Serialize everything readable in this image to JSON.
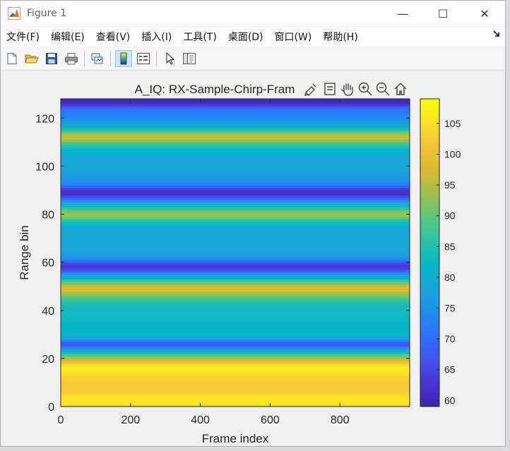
{
  "window": {
    "title": "Figure 1",
    "controls": {
      "minimize": "—",
      "maximize": "☐",
      "close": "✕"
    }
  },
  "menu": [
    "文件(F)",
    "编辑(E)",
    "查看(V)",
    "插入(I)",
    "工具(T)",
    "桌面(D)",
    "窗口(W)",
    "帮助(H)"
  ],
  "menu_overflow_icon": "arrow-icon",
  "toolbar": {
    "icons": [
      "new-figure-icon",
      "open-file-icon",
      "save-icon",
      "print-icon",
      "link-plot-icon",
      "colorbar-icon",
      "legend-icon",
      "pointer-icon",
      "property-inspector-icon"
    ]
  },
  "axes_toolbar": {
    "icons": [
      "data-tip-icon",
      "brush-icon",
      "pan-icon",
      "zoom-in-icon",
      "zoom-out-icon",
      "home-icon"
    ]
  },
  "chart_data": {
    "type": "heatmap",
    "title": "A_IQ: RX-Sample-Chirp-Fram",
    "xlabel": "Frame index",
    "ylabel": "Range bin",
    "xlim": [
      0,
      1000
    ],
    "ylim": [
      0,
      128
    ],
    "xticks": [
      0,
      200,
      400,
      600,
      800
    ],
    "yticks": [
      0,
      20,
      40,
      60,
      80,
      100,
      120
    ],
    "colorbar": {
      "colormap": "parula",
      "range": [
        59,
        109
      ],
      "ticks": [
        60,
        65,
        70,
        75,
        80,
        85,
        90,
        95,
        100,
        105
      ]
    },
    "range_profile": {
      "bins": [
        0,
        2,
        4,
        6,
        8,
        10,
        12,
        14,
        15,
        16,
        17,
        18,
        19,
        20,
        22,
        24,
        25,
        26,
        27,
        28,
        30,
        34,
        38,
        42,
        44,
        46,
        48,
        49,
        50,
        51,
        52,
        54,
        56,
        57,
        58,
        59,
        60,
        62,
        66,
        70,
        74,
        76,
        78,
        79,
        80,
        81,
        82,
        84,
        86,
        87,
        88,
        89,
        90,
        91,
        92,
        94,
        100,
        104,
        106,
        108,
        110,
        111,
        112,
        113,
        114,
        115,
        116,
        118,
        120,
        122,
        124,
        125,
        126,
        127
      ],
      "values": [
        103,
        106,
        105,
        103,
        102,
        102,
        103,
        105,
        106,
        107,
        106,
        103,
        99,
        95,
        86,
        76,
        70,
        66,
        69,
        76,
        82,
        82,
        83,
        84,
        86,
        91,
        96,
        99,
        97,
        94,
        88,
        80,
        71,
        66,
        63,
        64,
        67,
        76,
        79,
        79,
        79,
        82,
        87,
        92,
        94,
        92,
        88,
        81,
        72,
        67,
        63,
        61,
        62,
        66,
        71,
        75,
        79,
        79,
        81,
        84,
        89,
        94,
        97,
        95,
        91,
        86,
        82,
        77,
        74,
        72,
        70,
        66,
        62,
        60
      ]
    }
  }
}
